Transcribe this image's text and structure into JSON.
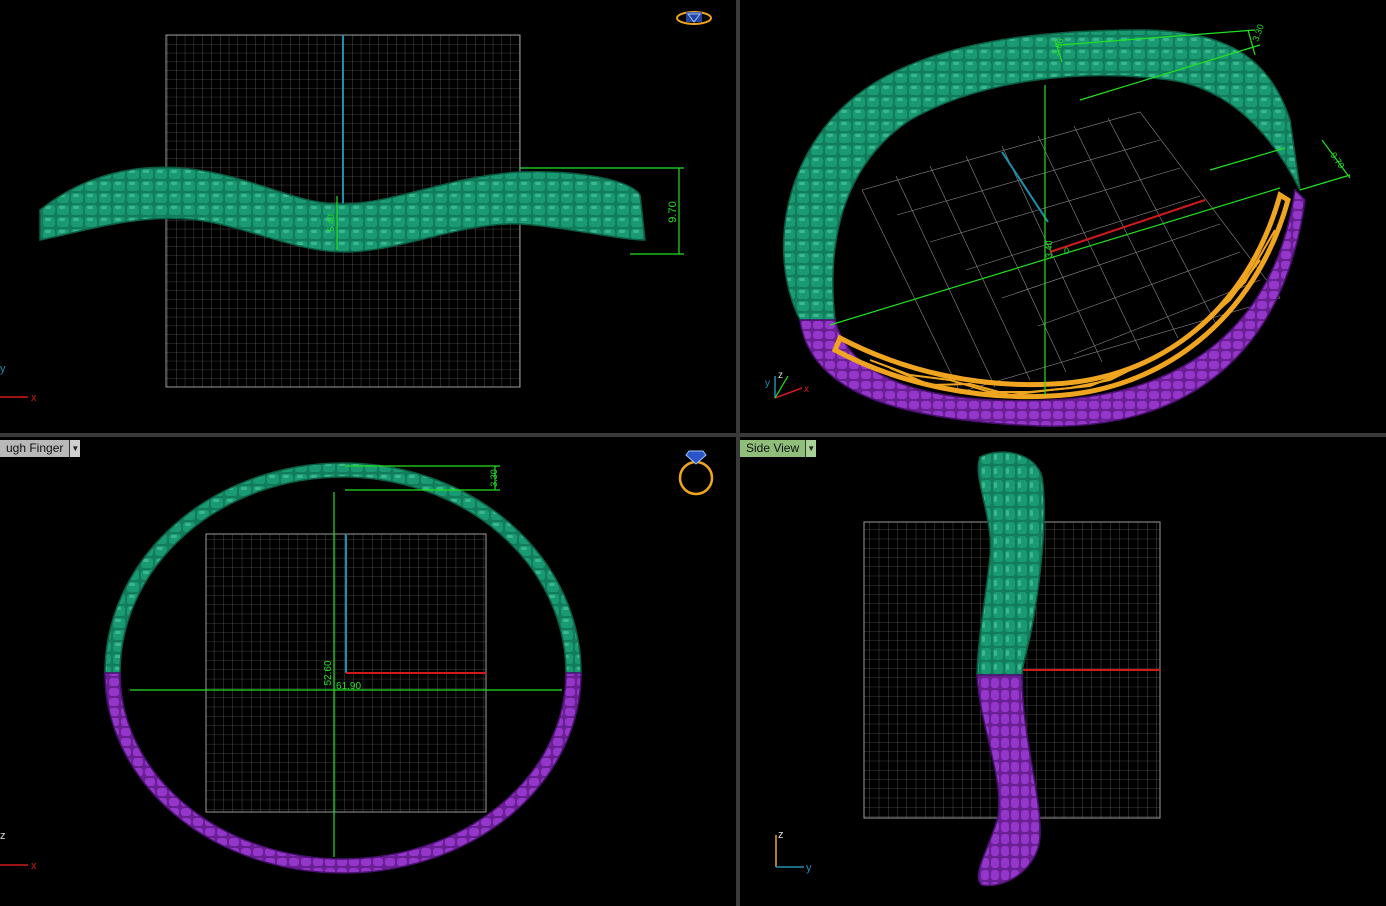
{
  "viewports": {
    "top_left": {
      "dimension_height": "9.70",
      "dimension_small": "5.40",
      "axes": {
        "vertical": "y",
        "horizontal": "x"
      }
    },
    "top_right": {
      "dimensions": [
        "3.80",
        "3.30",
        "9.70",
        "3.40",
        "0"
      ],
      "axes": {
        "vertical": "z",
        "horizontal": "x",
        "third": "y"
      }
    },
    "bottom_left": {
      "view_label": "ugh Finger",
      "dimension_width": "61.90",
      "dimension_height": "52.60",
      "dimension_thickness": "3.30",
      "axes": {
        "vertical": "z",
        "horizontal": "x"
      }
    },
    "bottom_right": {
      "view_label": "Side View",
      "axes": {
        "vertical": "z",
        "horizontal": "y"
      }
    }
  },
  "colors": {
    "background": "#000000",
    "grid": "#8a8a8a",
    "dimension": "#22e022",
    "band_green": "#0f7a5a",
    "band_purple": "#8a2dbb",
    "gallery_gold": "#f0a520",
    "axis_red": "#d11a1a",
    "axis_blue": "#1f8fb0"
  },
  "icons": {
    "top_left_widget": "ring-top-view-icon",
    "bottom_left_widget": "ring-front-view-icon"
  }
}
